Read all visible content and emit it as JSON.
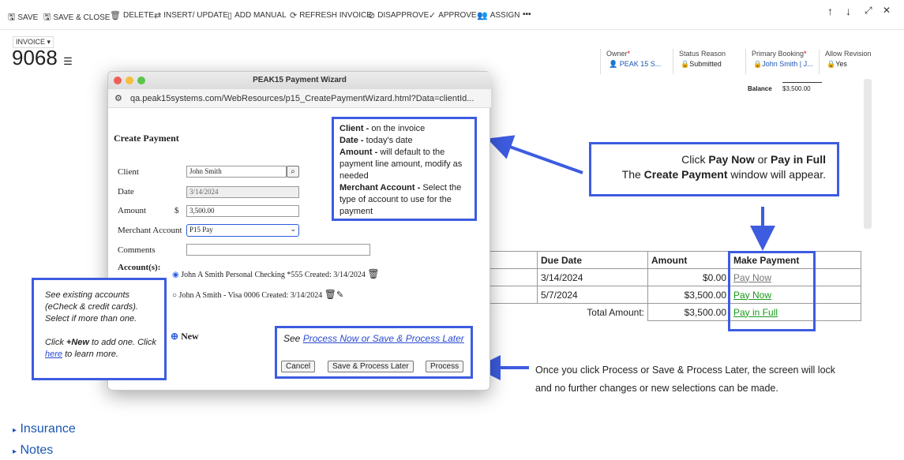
{
  "toolbar": {
    "save": "SAVE",
    "save_close": "SAVE & CLOSE",
    "delete": "DELETE",
    "insert_update": "INSERT/ UPDATE",
    "add_manual": "ADD MANUAL",
    "refresh_invoice": "REFRESH INVOICE",
    "disapprove": "DISAPPROVE",
    "approve": "APPROVE",
    "assign": "ASSIGN",
    "more": "•••"
  },
  "record": {
    "type": "INVOICE",
    "number": "9068"
  },
  "header_fields": {
    "owner_label": "Owner",
    "owner_value": "PEAK 15 S...",
    "status_label": "Status Reason",
    "status_value": "Submitted",
    "booking_label": "Primary Booking",
    "booking_value": "John Smith | J...",
    "revision_label": "Allow Revision",
    "revision_value": "Yes",
    "required_mark": "*"
  },
  "balance": {
    "label": "Balance",
    "value": "$3,500.00"
  },
  "payments_table": {
    "headers": [
      "Due Date",
      "Amount",
      "Make Payment"
    ],
    "rows": [
      {
        "due": "3/14/2024",
        "amount": "$0.00",
        "action": "Pay Now"
      },
      {
        "due": "5/7/2024",
        "amount": "$3,500.00",
        "action": "Pay Now"
      }
    ],
    "total_label": "Total Amount:",
    "total_value": "$3,500.00",
    "total_action": "Pay in Full"
  },
  "popup": {
    "window_title": "PEAK15 Payment Wizard",
    "url": "qa.peak15systems.com/WebResources/p15_CreatePaymentWizard.html?Data=clientId...",
    "heading": "Create Payment",
    "client_label": "Client",
    "client_value": "John Smith",
    "date_label": "Date",
    "date_value": "3/14/2024",
    "amount_label": "Amount",
    "currency": "$",
    "amount_value": "3,500.00",
    "merchant_label": "Merchant Account",
    "merchant_value": "P15 Pay",
    "comments_label": "Comments",
    "comments_value": "",
    "accounts_label": "Account(s):",
    "account1": "John A Smith Personal Checking *555 Created: 3/14/2024",
    "account2": "John A Smith - Visa 0006 Created: 3/14/2024",
    "new_label": "New",
    "see_label": "See",
    "see_link": "Process Now or Save & Process Later",
    "cancel": "Cancel",
    "save_process_later": "Save & Process Later",
    "process": "Process"
  },
  "callouts": {
    "fields_client_b": "Client -",
    "fields_client_t": " on the invoice",
    "fields_date_b": "Date -",
    "fields_date_t": " today's date",
    "fields_amount_b": "Amount -",
    "fields_amount_t": " will default to the payment line amount, modify as needed",
    "fields_merchant_b": "Merchant Account -",
    "fields_merchant_t": " Select the type of account to use for the payment",
    "click_1": "Click ",
    "click_paynow": "Pay Now",
    "click_or": " or ",
    "click_payfull": "Pay in Full",
    "click_the": "The ",
    "click_create": "Create Payment",
    "click_window": " window will appear.",
    "accounts_1": "See existing accounts (eCheck & credit cards). Select if more than one.",
    "accounts_2a": "Click ",
    "accounts_2b": "+New",
    "accounts_2c": " to add one. Click ",
    "accounts_here": "here",
    "accounts_2d": " to learn more.",
    "lock_line1": "Once you click Process or Save & Process Later, the screen will lock",
    "lock_line2": "and no further changes or new selections can be made."
  },
  "sections": {
    "insurance": "Insurance",
    "notes": "Notes"
  },
  "colors": {
    "callout_blue": "#3d5ce0",
    "link_green": "#1a9a1a",
    "link_blue": "#1a56b4"
  }
}
